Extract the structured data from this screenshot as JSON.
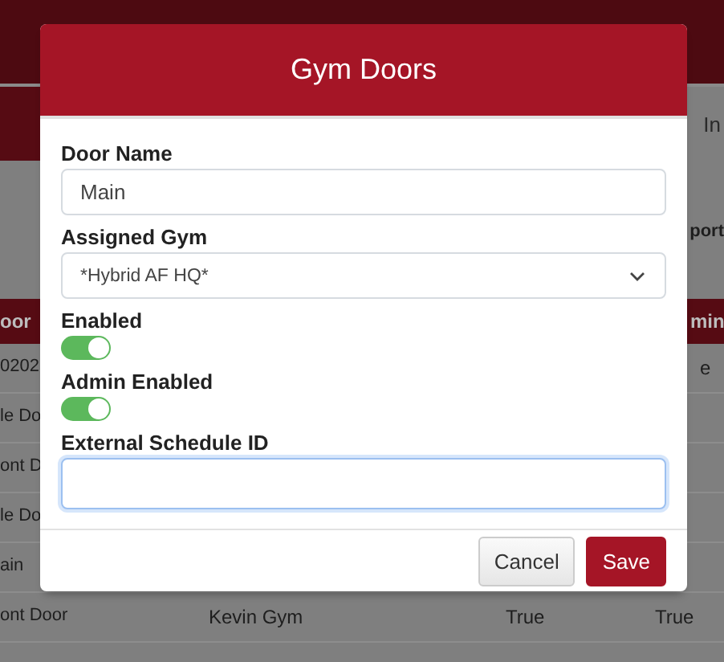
{
  "page": {
    "nav_text": "In",
    "filter_label": "port",
    "table": {
      "header": {
        "column_1": "oor",
        "column_4": "min"
      },
      "rows": [
        {
          "column_1": "0202",
          "column_4": "e"
        },
        {
          "column_1": "le Do"
        },
        {
          "column_1": "ont D"
        },
        {
          "column_1": "le Do"
        },
        {
          "column_1": "ain"
        },
        {
          "column_1": "ont Door",
          "column_2": "Kevin Gym",
          "column_3": "True",
          "column_4": "True"
        }
      ]
    }
  },
  "dialog": {
    "title": "Gym Doors",
    "fields": [
      {
        "kind": "text",
        "label": "Door Name",
        "value": "Main",
        "focused": false
      },
      {
        "kind": "select",
        "label": "Assigned Gym",
        "value": "*Hybrid AF HQ*"
      },
      {
        "kind": "toggle",
        "label": "Enabled",
        "on": true
      },
      {
        "kind": "toggle",
        "label": "Admin Enabled",
        "on": true
      },
      {
        "kind": "text",
        "label": "External Schedule ID",
        "focused": true
      }
    ],
    "buttons": [
      {
        "kind": "secondary",
        "label": "Cancel"
      },
      {
        "kind": "primary",
        "label": "Save"
      }
    ]
  }
}
